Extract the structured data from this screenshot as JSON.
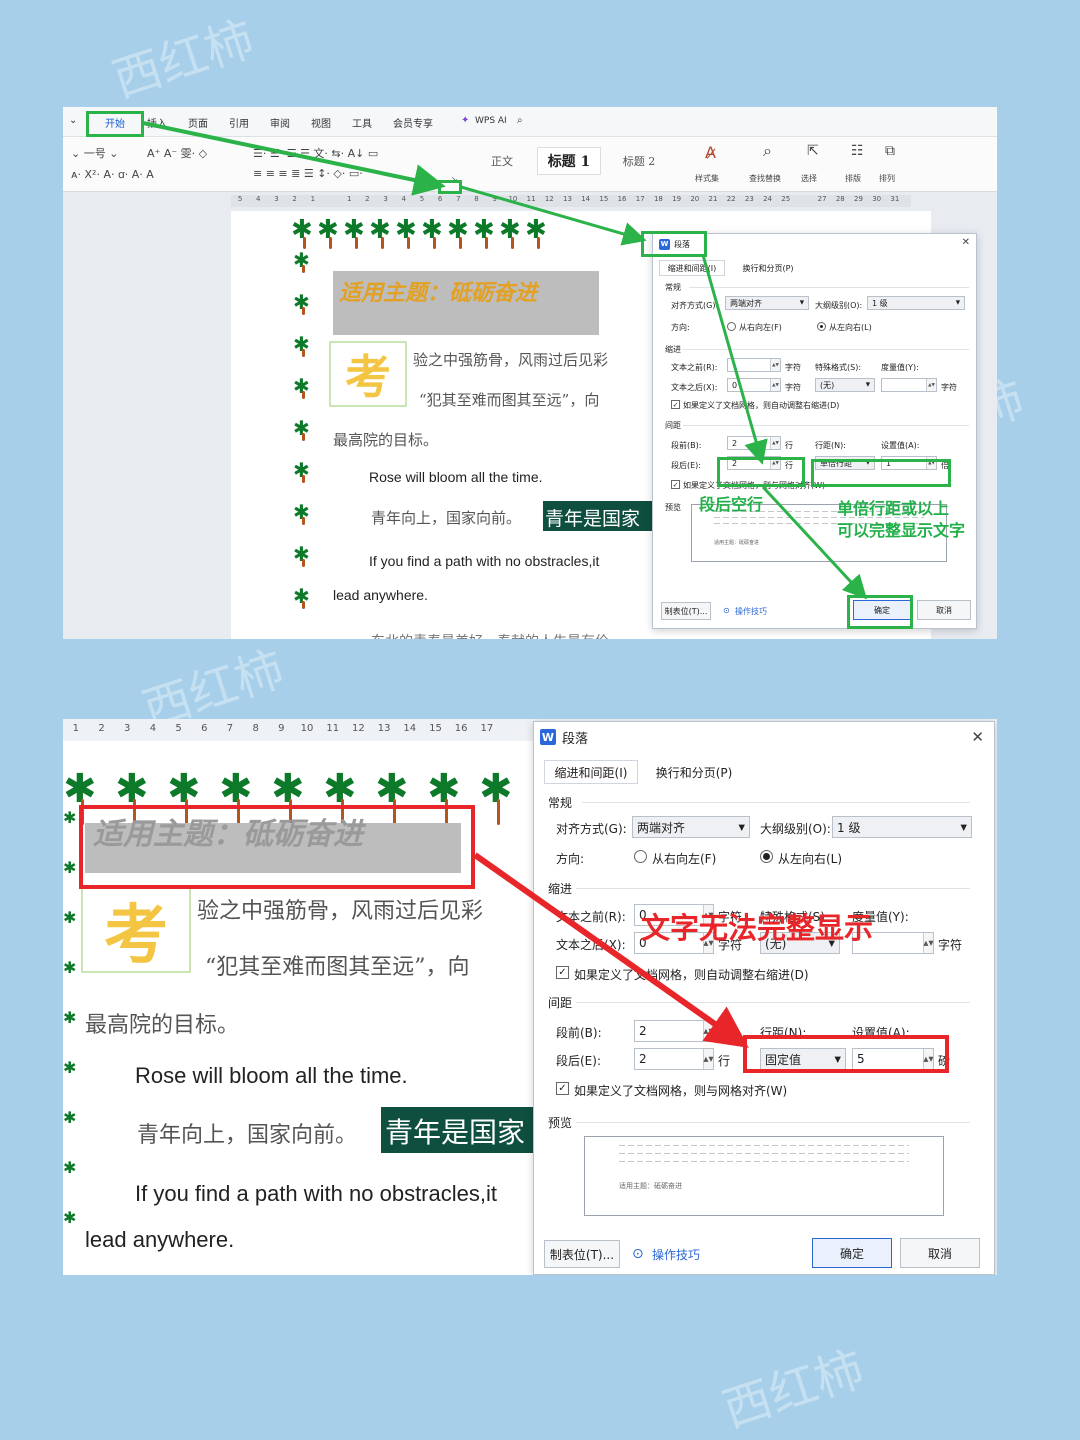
{
  "watermark": "西红柿",
  "ribbon": {
    "tabs": [
      "开始",
      "插入",
      "页面",
      "引用",
      "审阅",
      "视图",
      "工具",
      "会员专享",
      "WPS AI"
    ],
    "styles": {
      "normal": "正文",
      "heading1": "标题 1",
      "heading2": "标题 2"
    },
    "labels": [
      "样式集",
      "查找替换",
      "选择",
      "排版",
      "排列"
    ]
  },
  "ruler_top": [
    "5",
    "4",
    "3",
    "2",
    "1",
    "",
    "1",
    "2",
    "3",
    "4",
    "5",
    "6",
    "7",
    "8",
    "9",
    "10",
    "11",
    "12",
    "13",
    "14",
    "15",
    "16",
    "17",
    "18",
    "19",
    "20",
    "21",
    "22",
    "23",
    "24",
    "25",
    "",
    "27",
    "28",
    "29",
    "30",
    "31"
  ],
  "ruler_bottom": [
    "1",
    "2",
    "3",
    "4",
    "5",
    "6",
    "7",
    "8",
    "9",
    "10",
    "11",
    "12",
    "13",
    "14",
    "15",
    "16",
    "17"
  ],
  "document": {
    "title": "适用主题：砥砺奋进",
    "kao_char": "考",
    "line1": "验之中强筋骨，风雨过后见彩",
    "line2": "“犯其至难而图其至远”，向",
    "line3": "最高院的目标。",
    "english1": "Rose will bloom all the time.",
    "line4": "青年向上，国家向前。",
    "highlight": "青年是国家",
    "english2": "If you find a path with no obstracles,it",
    "english3": "lead anywhere.",
    "footer_line": "东北的青春最美好，奉献的人生最有价"
  },
  "dialog": {
    "title": "段落",
    "close": "✕",
    "tabs": [
      "缩进和间距(I)",
      "换行和分页(P)"
    ],
    "general": "常规",
    "align_label": "对齐方式(G):",
    "align_value": "两端对齐",
    "outline_label": "大纲级别(O):",
    "outline_value": "1 级",
    "direction_label": "方向:",
    "rtl": "从右向左(F)",
    "ltr": "从左向右(L)",
    "indent": "缩进",
    "before_text_label": "文本之前(R):",
    "before_text_value": "0",
    "after_text_label": "文本之后(X):",
    "after_text_value": "0",
    "unit_char": "字符",
    "special_label": "特殊格式(S):",
    "special_value": "(无)",
    "measure_label": "度量值(Y):",
    "auto_indent": "如果定义了文档网格，则自动调整右缩进(D)",
    "spacing": "间距",
    "before_label": "段前(B):",
    "before_value": "2",
    "after_label": "段后(E):",
    "after_value": "2",
    "unit_line": "行",
    "line_spacing_label": "行距(N):",
    "setting_label": "设置值(A):",
    "snap_grid": "如果定义了文档网格，则与网格对齐(W)",
    "preview": "预览",
    "preview_text": "适用主题：砥砺奋进",
    "tabs_button": "制表位(T)...",
    "tips": "操作技巧",
    "ok": "确定",
    "cancel": "取消"
  },
  "dialog_top": {
    "line_spacing_value": "单倍行距",
    "setting_value": "1",
    "setting_unit": "倍"
  },
  "dialog_bottom": {
    "line_spacing_value": "固定值",
    "setting_value": "5",
    "setting_unit": "磅"
  },
  "annotations": {
    "after_blank": "段后空行",
    "single_spacing_1": "单倍行距或以上",
    "single_spacing_2": "可以完整显示文字",
    "cannot_display": "文字无法完整显示"
  },
  "colors": {
    "green_mark": "#2bb34a",
    "red_mark": "#e8262a",
    "accent": "#2a67d8"
  }
}
